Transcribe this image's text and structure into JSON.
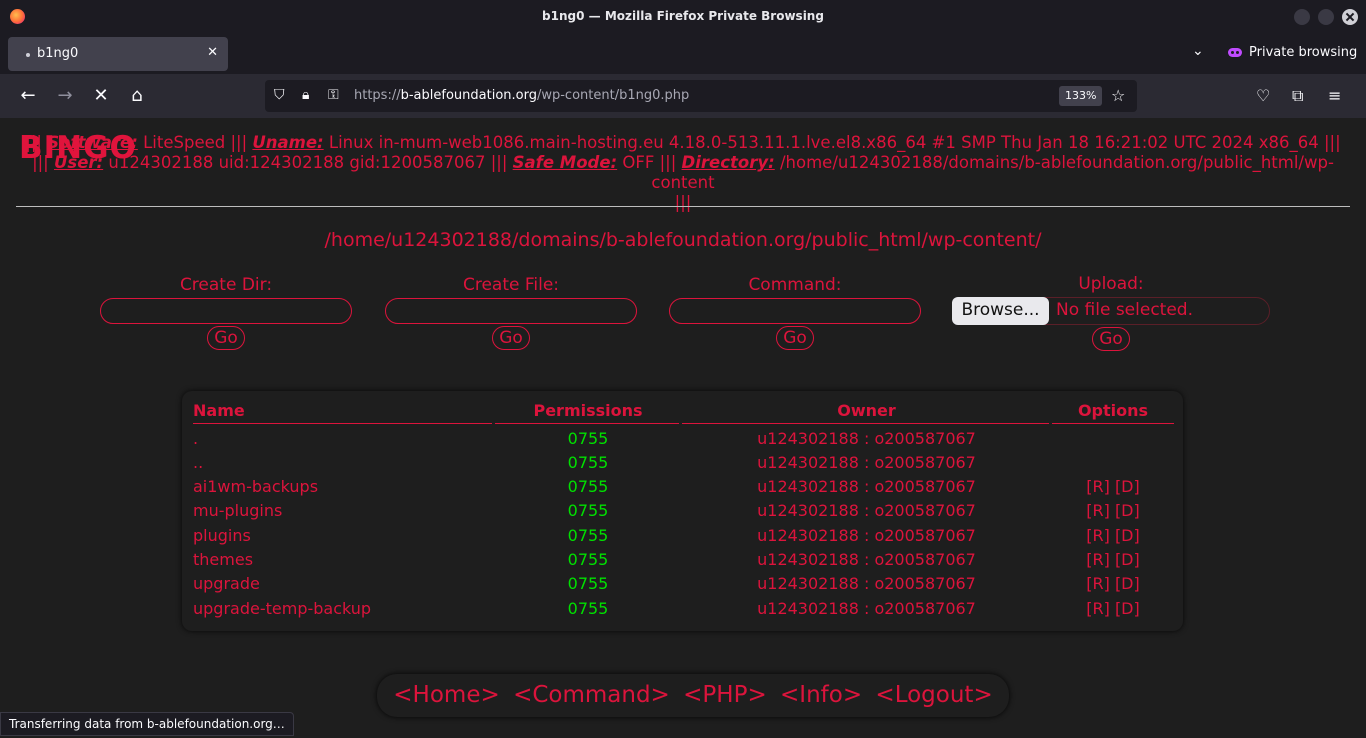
{
  "window": {
    "title": "b1ng0 — Mozilla Firefox Private Browsing"
  },
  "tab": {
    "label": "b1ng0",
    "close": "✕"
  },
  "private_label": "Private browsing",
  "url": {
    "prefix": "https://",
    "host": "b-ablefoundation.org",
    "path": "/wp-content/b1ng0.php",
    "zoom": "133%"
  },
  "page": {
    "logo": "BINGO",
    "sysinfo": {
      "line1_prefix": "|||",
      "software_label": "Software:",
      "software_value": "LiteSpeed |||",
      "uname_label": "Uname:",
      "uname_value": "Linux in-mum-web1086.main-hosting.eu 4.18.0-513.11.1.lve.el8.x86_64 #1 SMP Thu Jan 18 16:21:02 UTC 2024 x86_64 |||",
      "line2_prefix": "|||",
      "user_label": "User:",
      "user_value": "u124302188 uid:124302188 gid:1200587067 |||",
      "safemode_label": "Safe Mode:",
      "safemode_value": "OFF |||",
      "dir_label": "Directory:",
      "dir_value": "/home/u124302188/domains/b-ablefoundation.org/public_html/wp-content",
      "line3": "|||"
    },
    "current_path": "/home/u124302188/domains/b-ablefoundation.org/public_html/wp-content/",
    "forms": {
      "create_dir": "Create Dir:",
      "create_file": "Create File:",
      "command": "Command:",
      "upload": "Upload:",
      "go": "Go",
      "browse": "Browse...",
      "no_file": "No file selected."
    },
    "table": {
      "headers": {
        "name": "Name",
        "permissions": "Permissions",
        "owner": "Owner",
        "options": "Options"
      },
      "rows": [
        {
          "name": ".",
          "perm": "0755",
          "owner": "u124302188 : o200587067",
          "options": ""
        },
        {
          "name": "..",
          "perm": "0755",
          "owner": "u124302188 : o200587067",
          "options": ""
        },
        {
          "name": "ai1wm-backups",
          "perm": "0755",
          "owner": "u124302188 : o200587067",
          "options": "[R] [D]"
        },
        {
          "name": "mu-plugins",
          "perm": "0755",
          "owner": "u124302188 : o200587067",
          "options": "[R] [D]"
        },
        {
          "name": "plugins",
          "perm": "0755",
          "owner": "u124302188 : o200587067",
          "options": "[R] [D]"
        },
        {
          "name": "themes",
          "perm": "0755",
          "owner": "u124302188 : o200587067",
          "options": "[R] [D]"
        },
        {
          "name": "upgrade",
          "perm": "0755",
          "owner": "u124302188 : o200587067",
          "options": "[R] [D]"
        },
        {
          "name": "upgrade-temp-backup",
          "perm": "0755",
          "owner": "u124302188 : o200587067",
          "options": "[R] [D]"
        }
      ]
    },
    "menu": {
      "home": "<Home>",
      "command": "<Command>",
      "php": "<PHP>",
      "info": "<Info>",
      "logout": "<Logout>"
    }
  },
  "status": "Transferring data from b-ablefoundation.org…",
  "colors": {
    "accent": "#dc143c",
    "perm": "#00e000",
    "bg": "#1e1e1e"
  }
}
